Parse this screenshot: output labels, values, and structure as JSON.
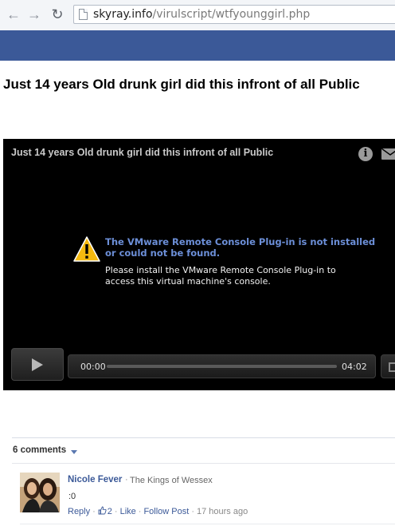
{
  "browser": {
    "url_domain": "skyray.info",
    "url_path": "/virulscript/wtfyounggirl.php",
    "back_icon": "back-arrow-icon",
    "forward_icon": "forward-arrow-icon",
    "reload_icon": "reload-icon"
  },
  "colors": {
    "facebook_bar": "#3b5998",
    "link": "#3b5998",
    "plugin_error_title": "#6c8fd8"
  },
  "page": {
    "headline": "Just 14 years Old drunk girl did this infront of all Public"
  },
  "player": {
    "title": "Just 14 years Old drunk girl did this infront of all Public",
    "info_icon": "i",
    "error_title": "The VMware Remote Console Plug-in is not installed or could not be found.",
    "error_body": "Please install the VMware Remote Console Plug-in to access this virtual machine's console.",
    "current_time": "00:00",
    "duration": "04:02",
    "progress": 0
  },
  "comments": {
    "count_label": "6 comments",
    "items": [
      {
        "author": "Nicole Fever",
        "affiliation": "The Kings of Wessex",
        "text": ":0",
        "reply_label": "Reply",
        "likes": "2",
        "like_label": "Like",
        "follow_label": "Follow Post",
        "time": "17 hours ago"
      }
    ]
  }
}
